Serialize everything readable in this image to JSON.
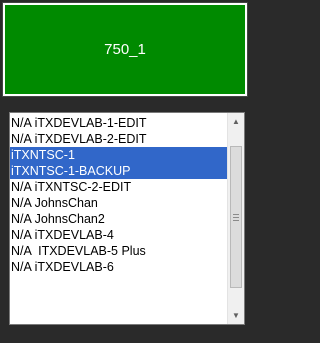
{
  "main_button": {
    "label": "750_1",
    "color": "#008a00"
  },
  "list": {
    "selection_color": "#3167c9",
    "items": [
      {
        "label": "N/A iTXDEVLAB-1-EDIT",
        "selected": false
      },
      {
        "label": "N/A iTXDEVLAB-2-EDIT",
        "selected": false
      },
      {
        "label": "iTXNTSC-1",
        "selected": true
      },
      {
        "label": "iTXNTSC-1-BACKUP",
        "selected": true
      },
      {
        "label": "N/A iTXNTSC-2-EDIT",
        "selected": false
      },
      {
        "label": "N/A JohnsChan",
        "selected": false
      },
      {
        "label": "N/A JohnsChan2",
        "selected": false
      },
      {
        "label": "N/A iTXDEVLAB-4",
        "selected": false
      },
      {
        "label": "N/A  ITXDEVLAB-5 Plus",
        "selected": false
      },
      {
        "label": "N/A iTXDEVLAB-6",
        "selected": false
      }
    ]
  },
  "scrollbar": {
    "up_icon": "up-arrow-icon",
    "down_icon": "down-arrow-icon",
    "up_glyph": "▲",
    "down_glyph": "▼"
  }
}
